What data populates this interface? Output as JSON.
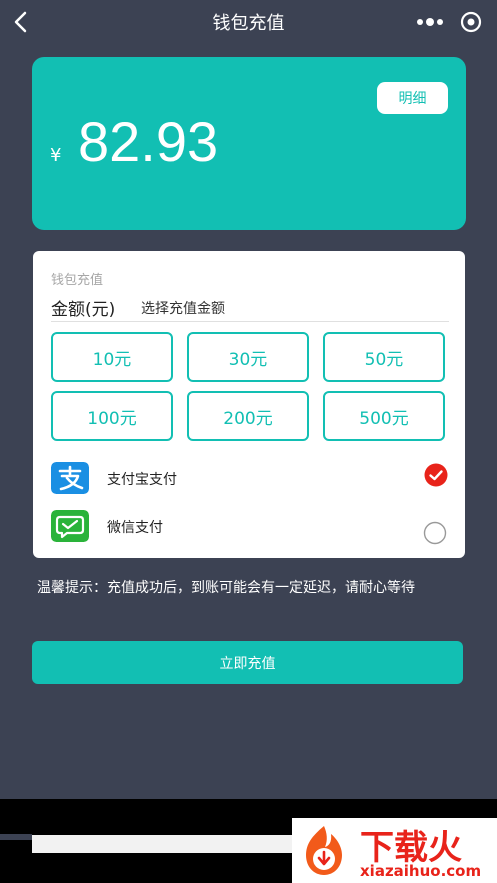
{
  "navbar": {
    "title": "钱包充值",
    "back_icon": "chevron-left-icon",
    "more_icon": "more-dots-icon",
    "close_icon": "target-circle-icon"
  },
  "balance": {
    "currency": "¥",
    "amount": "82.93",
    "detail_label": "明细"
  },
  "recharge": {
    "title": "钱包充值",
    "amount_label": "金额(元)",
    "amount_placeholder": "选择充值金额",
    "options": [
      "10元",
      "30元",
      "50元",
      "100元",
      "200元",
      "500元"
    ]
  },
  "payment": {
    "methods": [
      {
        "label": "支付宝支付",
        "icon": "alipay-icon",
        "selected": true
      },
      {
        "label": "微信支付",
        "icon": "wechat-icon",
        "selected": false
      }
    ]
  },
  "tip": "温馨提示：充值成功后，到账可能会有一定延迟，请耐心等待",
  "submit_label": "立即充值",
  "watermark": {
    "text": "下载火",
    "domain": "xiazaihuo.com"
  },
  "colors": {
    "background": "#3c4253",
    "accent": "#12bfb3",
    "selected": "#e8231a",
    "wechat": "#2ab33a",
    "alipay": "#1a8fe3"
  }
}
